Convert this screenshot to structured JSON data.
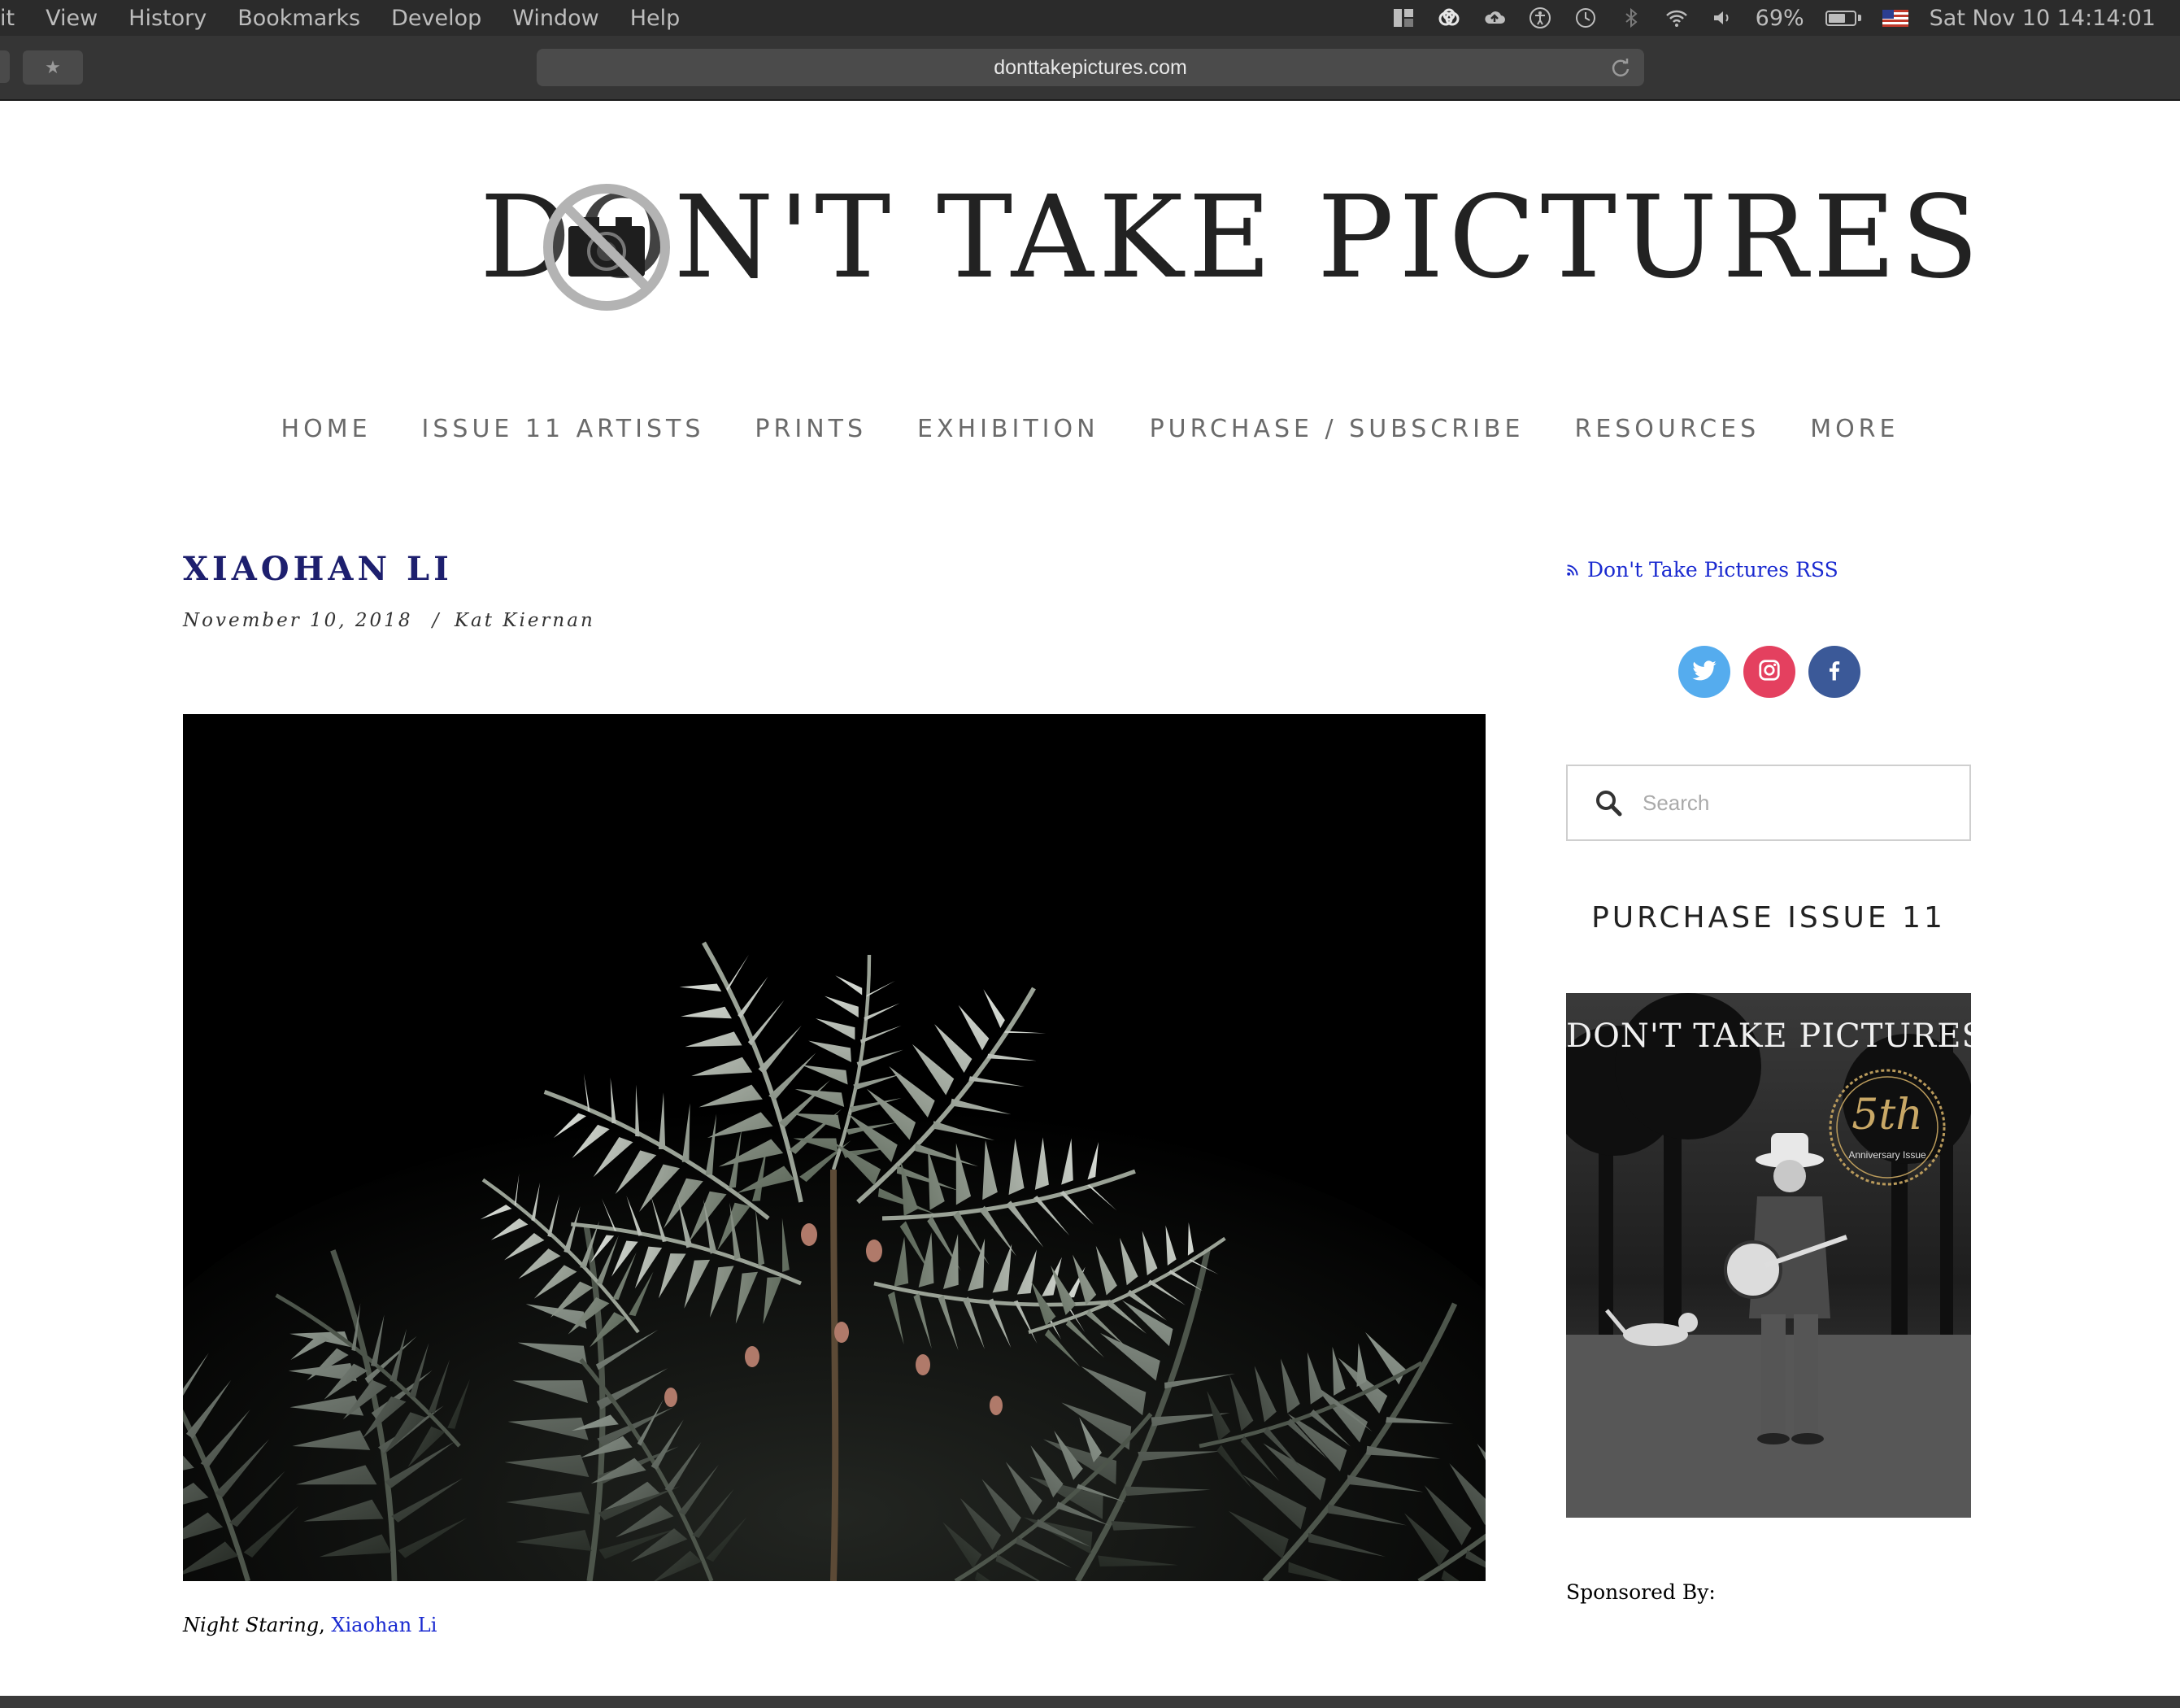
{
  "menubar": {
    "menus": [
      "it",
      "View",
      "History",
      "Bookmarks",
      "Develop",
      "Window",
      "Help"
    ],
    "status": {
      "battery_percent": "69%",
      "battery_level": 0.69,
      "datetime": "Sat Nov 10  14:14:01"
    }
  },
  "browser": {
    "url": "donttakepictures.com"
  },
  "site": {
    "logo_text": "DON'T TAKE PICTURES"
  },
  "nav": {
    "items": [
      "HOME",
      "ISSUE 11 ARTISTS",
      "PRINTS",
      "EXHIBITION",
      "PURCHASE / SUBSCRIBE",
      "RESOURCES",
      "MORE"
    ]
  },
  "post": {
    "title": "XIAOHAN LI",
    "date": "November 10, 2018",
    "separator": "/",
    "author": "Kat Kiernan",
    "caption_title": "Night Staring",
    "caption_sep": ", ",
    "caption_artist": "Xiaohan Li"
  },
  "sidebar": {
    "rss_label": "Don't Take Pictures RSS",
    "search_placeholder": "Search",
    "purchase_heading": "PURCHASE ISSUE 11",
    "cover_title": "DON'T TAKE PICTURES",
    "cover_badge_main": "5th",
    "cover_badge_sub": "Anniversary Issue",
    "sponsored_label": "Sponsored By:"
  },
  "colors": {
    "twitter": "#55acee",
    "instagram": "#e4405f",
    "facebook": "#3b5998",
    "title": "#1d1f6e",
    "link": "#1a2ad0"
  }
}
